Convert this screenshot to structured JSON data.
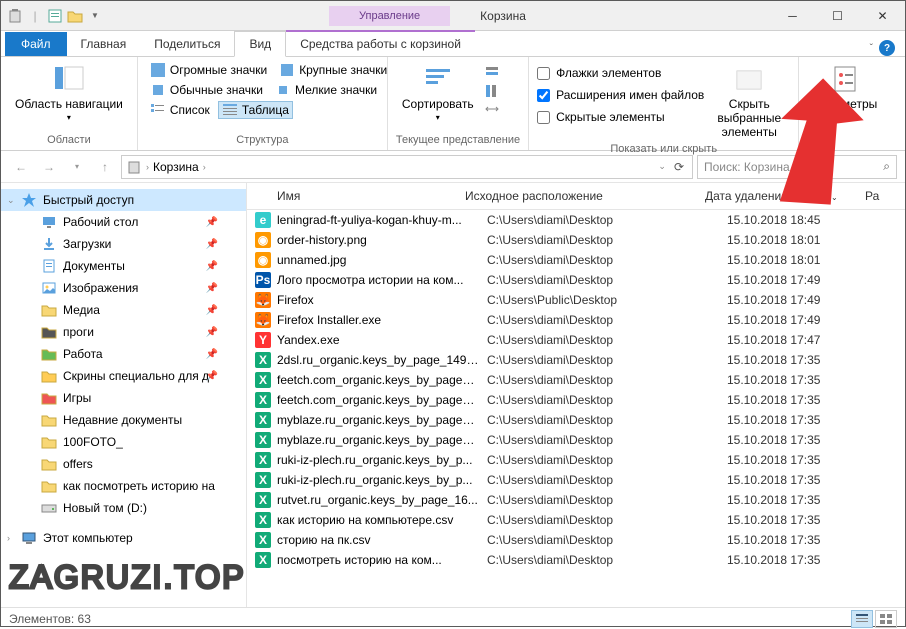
{
  "window": {
    "title": "Корзина",
    "context_tab": "Управление"
  },
  "tabs": {
    "file": "Файл",
    "home": "Главная",
    "share": "Поделиться",
    "view": "Вид",
    "tools": "Средства работы с корзиной"
  },
  "ribbon": {
    "nav_pane": "Область навигации",
    "grp_panes": "Области",
    "huge_icons": "Огромные значки",
    "large_icons": "Крупные значки",
    "normal_icons": "Обычные значки",
    "small_icons": "Мелкие значки",
    "list": "Список",
    "table": "Таблица",
    "grp_layout": "Структура",
    "sort": "Сортировать",
    "grp_current": "Текущее представление",
    "chk_checkboxes": "Флажки элементов",
    "chk_extensions": "Расширения имен файлов",
    "chk_hidden": "Скрытые элементы",
    "hide_selected": "Скрыть выбранные элементы",
    "grp_show": "Показать или скрыть",
    "options": "Параметры"
  },
  "address": {
    "location": "Корзина",
    "search_placeholder": "Поиск: Корзина"
  },
  "columns": {
    "name": "Имя",
    "location": "Исходное расположение",
    "date": "Дата удаления",
    "size": "Ра"
  },
  "nav": {
    "quick": "Быстрый доступ",
    "items": [
      {
        "label": "Рабочий стол",
        "icon": "desktop",
        "pin": true
      },
      {
        "label": "Загрузки",
        "icon": "downloads",
        "pin": true
      },
      {
        "label": "Документы",
        "icon": "documents",
        "pin": true
      },
      {
        "label": "Изображения",
        "icon": "pictures",
        "pin": true
      },
      {
        "label": "Медиа",
        "icon": "folder",
        "pin": true
      },
      {
        "label": "проги",
        "icon": "folder-dark",
        "pin": true
      },
      {
        "label": "Работа",
        "icon": "folder-green",
        "pin": true
      },
      {
        "label": "Скрины специально для д",
        "icon": "folder-yellow",
        "pin": true
      },
      {
        "label": "Игры",
        "icon": "folder-rainbow",
        "pin": false
      },
      {
        "label": "Недавние документы",
        "icon": "folder",
        "pin": false
      },
      {
        "label": "100FOTO_",
        "icon": "folder",
        "pin": false
      },
      {
        "label": "offers",
        "icon": "folder",
        "pin": false
      },
      {
        "label": "как посмотреть историю на",
        "icon": "folder",
        "pin": false
      },
      {
        "label": "Новый том (D:)",
        "icon": "drive",
        "pin": false
      }
    ],
    "thispc": "Этот компьютер"
  },
  "files": [
    {
      "icon": "ie",
      "name": "leningrad-ft-yuliya-kogan-khuy-m...",
      "loc": "C:\\Users\\diami\\Desktop",
      "date": "15.10.2018 18:45"
    },
    {
      "icon": "png",
      "name": "order-history.png",
      "loc": "C:\\Users\\diami\\Desktop",
      "date": "15.10.2018 18:01"
    },
    {
      "icon": "png",
      "name": "unnamed.jpg",
      "loc": "C:\\Users\\diami\\Desktop",
      "date": "15.10.2018 18:01"
    },
    {
      "icon": "ps",
      "name": "Лого просмотра истории на ком...",
      "loc": "C:\\Users\\diami\\Desktop",
      "date": "15.10.2018 17:49"
    },
    {
      "icon": "ff",
      "name": "Firefox",
      "loc": "C:\\Users\\Public\\Desktop",
      "date": "15.10.2018 17:49"
    },
    {
      "icon": "ff",
      "name": "Firefox Installer.exe",
      "loc": "C:\\Users\\diami\\Desktop",
      "date": "15.10.2018 17:49"
    },
    {
      "icon": "yx",
      "name": "Yandex.exe",
      "loc": "C:\\Users\\diami\\Desktop",
      "date": "15.10.2018 17:47"
    },
    {
      "icon": "xl",
      "name": "2dsl.ru_organic.keys_by_page_1490...",
      "loc": "C:\\Users\\diami\\Desktop",
      "date": "15.10.2018 17:35"
    },
    {
      "icon": "xl",
      "name": "feetch.com_organic.keys_by_page_...",
      "loc": "C:\\Users\\diami\\Desktop",
      "date": "15.10.2018 17:35"
    },
    {
      "icon": "xl",
      "name": "feetch.com_organic.keys_by_page_...",
      "loc": "C:\\Users\\diami\\Desktop",
      "date": "15.10.2018 17:35"
    },
    {
      "icon": "xl",
      "name": "myblaze.ru_organic.keys_by_page_...",
      "loc": "C:\\Users\\diami\\Desktop",
      "date": "15.10.2018 17:35"
    },
    {
      "icon": "xl",
      "name": "myblaze.ru_organic.keys_by_page_...",
      "loc": "C:\\Users\\diami\\Desktop",
      "date": "15.10.2018 17:35"
    },
    {
      "icon": "xl",
      "name": "ruki-iz-plech.ru_organic.keys_by_p...",
      "loc": "C:\\Users\\diami\\Desktop",
      "date": "15.10.2018 17:35"
    },
    {
      "icon": "xl",
      "name": "ruki-iz-plech.ru_organic.keys_by_p...",
      "loc": "C:\\Users\\diami\\Desktop",
      "date": "15.10.2018 17:35"
    },
    {
      "icon": "xl",
      "name": "rutvet.ru_organic.keys_by_page_16...",
      "loc": "C:\\Users\\diami\\Desktop",
      "date": "15.10.2018 17:35"
    },
    {
      "icon": "xl",
      "name": "как историю на компьютере.csv",
      "loc": "C:\\Users\\diami\\Desktop",
      "date": "15.10.2018 17:35"
    },
    {
      "icon": "xl",
      "name": "сторию на пк.csv",
      "loc": "C:\\Users\\diami\\Desktop",
      "date": "15.10.2018 17:35"
    },
    {
      "icon": "xl",
      "name": "посмотреть историю на ком...",
      "loc": "C:\\Users\\diami\\Desktop",
      "date": "15.10.2018 17:35"
    }
  ],
  "status": {
    "count_label": "Элементов:",
    "count": "63"
  },
  "watermark": "ZAGRUZI.TOP"
}
